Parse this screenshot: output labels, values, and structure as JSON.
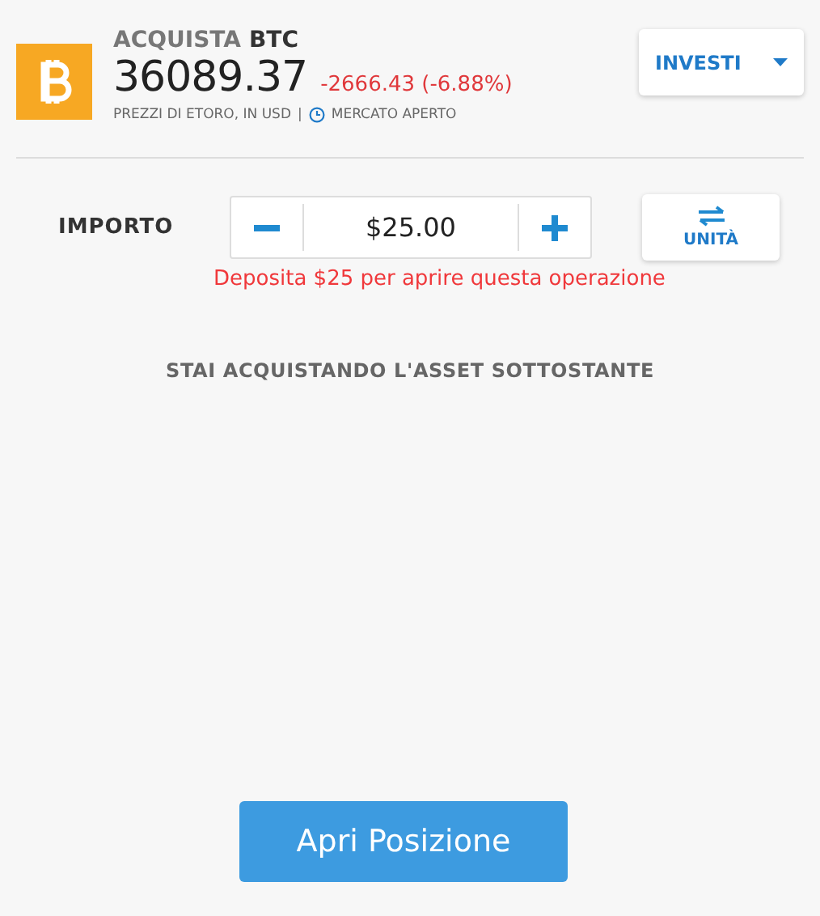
{
  "header": {
    "action": "ACQUISTA",
    "symbol": "BTC",
    "price": "36089.37",
    "change": "-2666.43 (-6.88%)",
    "source": "PREZZI DI ETORO, IN USD",
    "separator": "|",
    "market_status": "MERCATO APERTO"
  },
  "mode_dropdown": {
    "label": "INVESTI"
  },
  "amount": {
    "label": "IMPORTO",
    "value": "$25.00",
    "unit_button": "UNITÀ",
    "error": "Deposita $25 per aprire questa operazione"
  },
  "notice": "STAI ACQUISTANDO L'ASSET SOTTOSTANTE",
  "submit": "Apri Posizione"
}
